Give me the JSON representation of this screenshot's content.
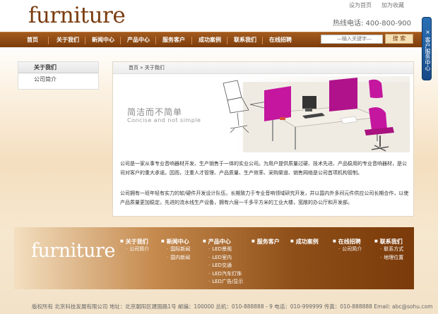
{
  "header": {
    "logo": "furniture",
    "links": [
      "设为首页",
      "加为收藏"
    ],
    "hotline": "热线电话: 400-800-900"
  },
  "side_tab": {
    "label": "客户服务中心",
    "close": "×"
  },
  "nav": {
    "items": [
      "首页",
      "关于我们",
      "新闻中心",
      "产品中心",
      "服务客户",
      "成功案例",
      "联系我们",
      "在线招聘"
    ]
  },
  "search": {
    "placeholder": "—输入关键字—",
    "button": "搜 索"
  },
  "sidebar": {
    "title": "关于我们",
    "items": [
      "公司简介"
    ]
  },
  "breadcrumb": "首页 » 关于我们",
  "banner": {
    "title_cn": "简洁而不简单",
    "title_en": "Concise and not simple"
  },
  "content": {
    "paragraphs": [
      "公司是一家从事专业音响器材开发、生产销售于一体的实业公司。为用户提供质量过硬、技术先进、产品稳用的专业音响器材，是公司对客户的重大承诺。因而，注重人才管理、产品质量、生产效率、采购渠道、销售网络是公司首项机构管制。",
      "公司拥有一班年轻有实力的软/硬件开发设计队伍，长期致力于专业音响领域研究开发，并以国内外多间元件供应公司长期合作，以使产品质量更加稳定。先进的流水线生产设备，拥有六层一千多平方米的工业大楼，宽敞的办公厅和开发部。"
    ]
  },
  "footer": {
    "logo": "furniture",
    "columns": [
      {
        "title": "关于我们",
        "items": [
          "公司简介"
        ]
      },
      {
        "title": "新闻中心",
        "items": [
          "国际新闻",
          "国内新闻"
        ]
      },
      {
        "title": "产品中心",
        "items": [
          "LED景观",
          "LED室内",
          "LED交通",
          "LED汽车灯饰",
          "LED广告/显示"
        ]
      },
      {
        "title": "服务客户",
        "items": []
      },
      {
        "title": "成功案例",
        "items": []
      },
      {
        "title": "在线招聘",
        "items": [
          "公司简介"
        ]
      },
      {
        "title": "联系我们",
        "items": [
          "联系方式",
          "地理位置"
        ]
      }
    ],
    "copyright": "版权所有  北京科技发展有限公司 地址：北京朝阳区建国路1号 邮编：100000  总机：010-888888 - 9 电话：010-999999 传真：010-888888 Email: abc@sohu.com"
  },
  "colors": {
    "brand": "#7a3c10",
    "nav_bg": "#8b4813",
    "accent": "#c4169e"
  }
}
